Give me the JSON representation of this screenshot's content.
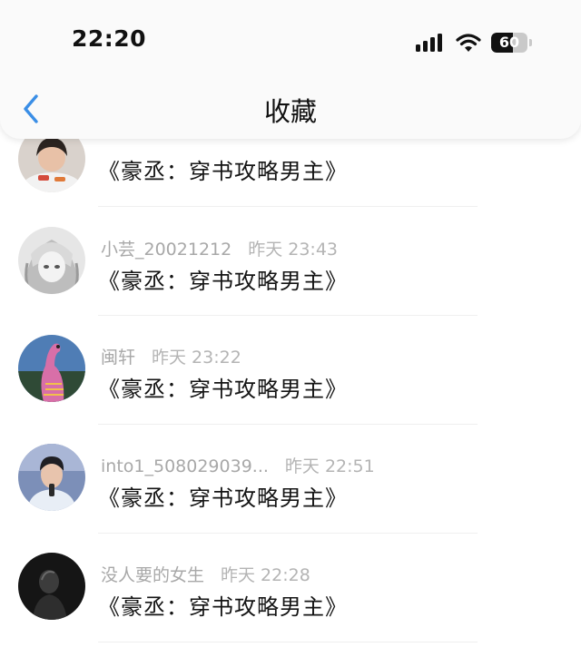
{
  "status_bar": {
    "time": "22:20",
    "battery_level": "60",
    "battery_percent": 60,
    "icons": [
      "signal-icon",
      "wifi-icon",
      "battery-icon"
    ]
  },
  "nav": {
    "title": "收藏",
    "back_icon": "chevron-left-icon"
  },
  "colors": {
    "accent": "#3a8ee6",
    "title_text": "#141414",
    "meta_text": "#a8a8a8",
    "header_bg": "#fafafa"
  },
  "items": [
    {
      "user": "",
      "time": "",
      "title": "《豪丞：穿书攻略男主》"
    },
    {
      "user": "小芸_20021212",
      "time": "昨天 23:43",
      "title": "《豪丞：穿书攻略男主》"
    },
    {
      "user": "闽轩",
      "time": "昨天 23:22",
      "title": "《豪丞：穿书攻略男主》"
    },
    {
      "user": "into1_508029039...",
      "time": "昨天 22:51",
      "title": "《豪丞：穿书攻略男主》"
    },
    {
      "user": "没人要的女生",
      "time": "昨天 22:28",
      "title": "《豪丞：穿书攻略男主》"
    }
  ]
}
